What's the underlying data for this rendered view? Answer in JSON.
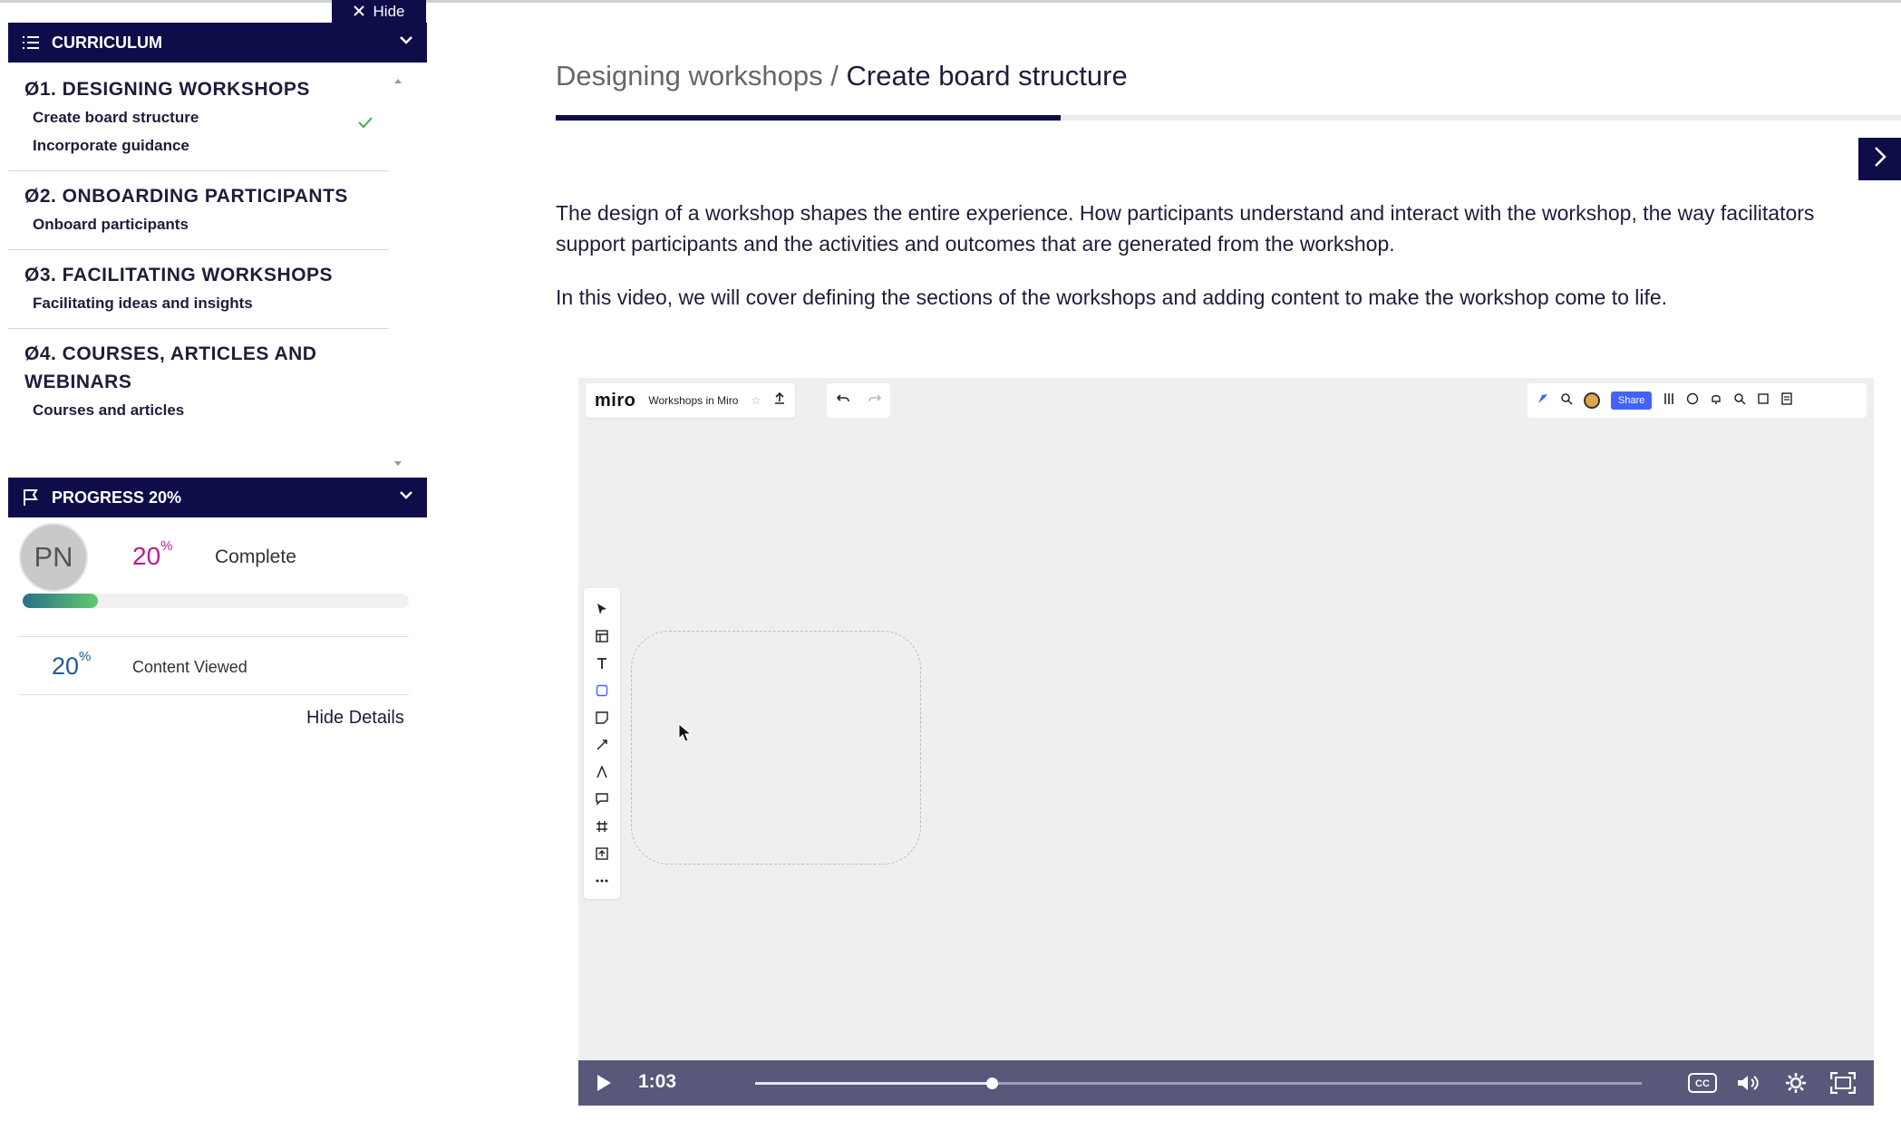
{
  "sidebar": {
    "hide_label": "Hide",
    "curriculum_title": "CURRICULUM",
    "sections": [
      {
        "title": "Ø1. DESIGNING WORKSHOPS",
        "lessons": [
          {
            "label": "Create board structure",
            "completed": true
          },
          {
            "label": "Incorporate guidance",
            "completed": false
          }
        ]
      },
      {
        "title": "Ø2. ONBOARDING PARTICIPANTS",
        "lessons": [
          {
            "label": "Onboard participants",
            "completed": false
          }
        ]
      },
      {
        "title": "Ø3. FACILITATING WORKSHOPS",
        "lessons": [
          {
            "label": "Facilitating ideas and insights",
            "completed": false
          }
        ]
      },
      {
        "title": "Ø4. COURSES, ARTICLES AND WEBINARS",
        "lessons": [
          {
            "label": "Courses and articles",
            "completed": false
          }
        ]
      }
    ],
    "progress_title": "PROGRESS 20%",
    "avatar_initials": "PN",
    "complete_pct": "20",
    "complete_pct_value": 0.2,
    "complete_label": "Complete",
    "viewed_pct": "20",
    "viewed_label": "Content Viewed",
    "percent_sign": "%",
    "hide_details_label": "Hide Details"
  },
  "main": {
    "breadcrumb_parent": "Designing workshops",
    "breadcrumb_separator": "/",
    "breadcrumb_current": "Create board structure",
    "lesson_progress": 0.375,
    "paragraph_1": "The design of a workshop shapes the entire experience. How participants understand and interact with the workshop, the way facilitators support participants and the activities and outcomes that are generated from the workshop.",
    "paragraph_2": "In this video, we will cover defining the sections of the workshops and adding content to make the workshop come to life."
  },
  "video": {
    "app_logo": "miro",
    "board_name": "Workshops in Miro",
    "share_label": "Share",
    "current_time": "1:03",
    "played_fraction": 0.267
  },
  "colors": {
    "navy": "#0f0c4a",
    "complete_pct": "#c2188d",
    "viewed_pct": "#1f5a96",
    "check_green": "#3ab34a",
    "share_blue": "#4262ff"
  },
  "icons": {
    "hide": "close-icon",
    "curriculum": "list-icon",
    "progress": "flag-icon",
    "collapse": "chevron-down-icon",
    "check": "checkmark-icon",
    "next": "chevron-right-icon",
    "play": "play-icon",
    "cc": "closed-captions-icon",
    "volume": "volume-icon",
    "settings": "gear-icon",
    "fullscreen": "fullscreen-icon"
  }
}
